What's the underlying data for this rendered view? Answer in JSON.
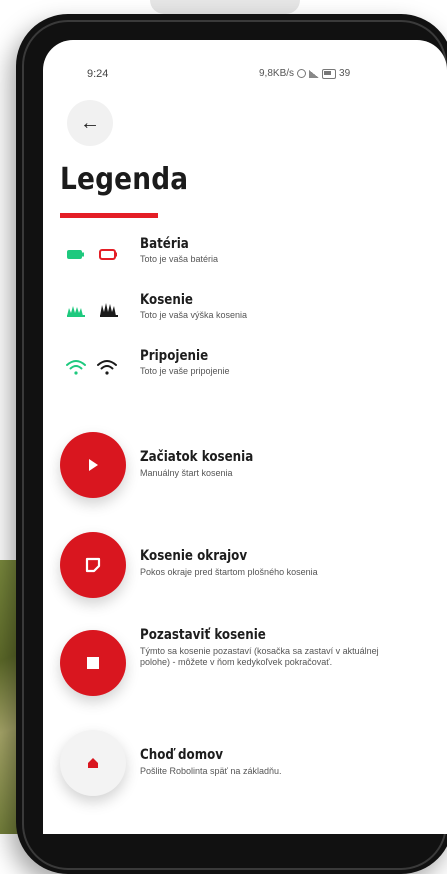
{
  "status": {
    "time": "9:24",
    "right_text": "9,8KB/s",
    "battery_text": "39"
  },
  "header": {
    "back_glyph": "←",
    "title": "Legenda"
  },
  "colors": {
    "accent_red": "#e41e26",
    "green": "#1ec97e"
  },
  "legend": [
    {
      "title": "Batéria",
      "subtitle": "Toto je vaša batéria",
      "icons": [
        "battery-green-icon",
        "battery-red-icon"
      ]
    },
    {
      "title": "Kosenie",
      "subtitle": "Toto je vaša výška kosenia",
      "icons": [
        "grass-green-icon",
        "grass-black-icon"
      ]
    },
    {
      "title": "Pripojenie",
      "subtitle": "Toto je vaše pripojenie",
      "icons": [
        "wifi-green-icon",
        "wifi-black-icon"
      ]
    }
  ],
  "actions": [
    {
      "title": "Začiatok kosenia",
      "subtitle": "Manuálny štart kosenia",
      "icon": "play-icon"
    },
    {
      "title": "Kosenie okrajov",
      "subtitle": "Pokos okraje pred štartom plošného kosenia",
      "icon": "edge-icon"
    },
    {
      "title": "Pozastaviť kosenie",
      "subtitle": "Týmto sa kosenie pozastaví (kosačka sa zastaví v aktuálnej polohe) - môžete v ňom kedykoľvek pokračovať.",
      "icon": "stop-icon"
    },
    {
      "title": "Choď domov",
      "subtitle": "Pošlite Robolinta späť na základňu.",
      "icon": "home-icon"
    }
  ]
}
